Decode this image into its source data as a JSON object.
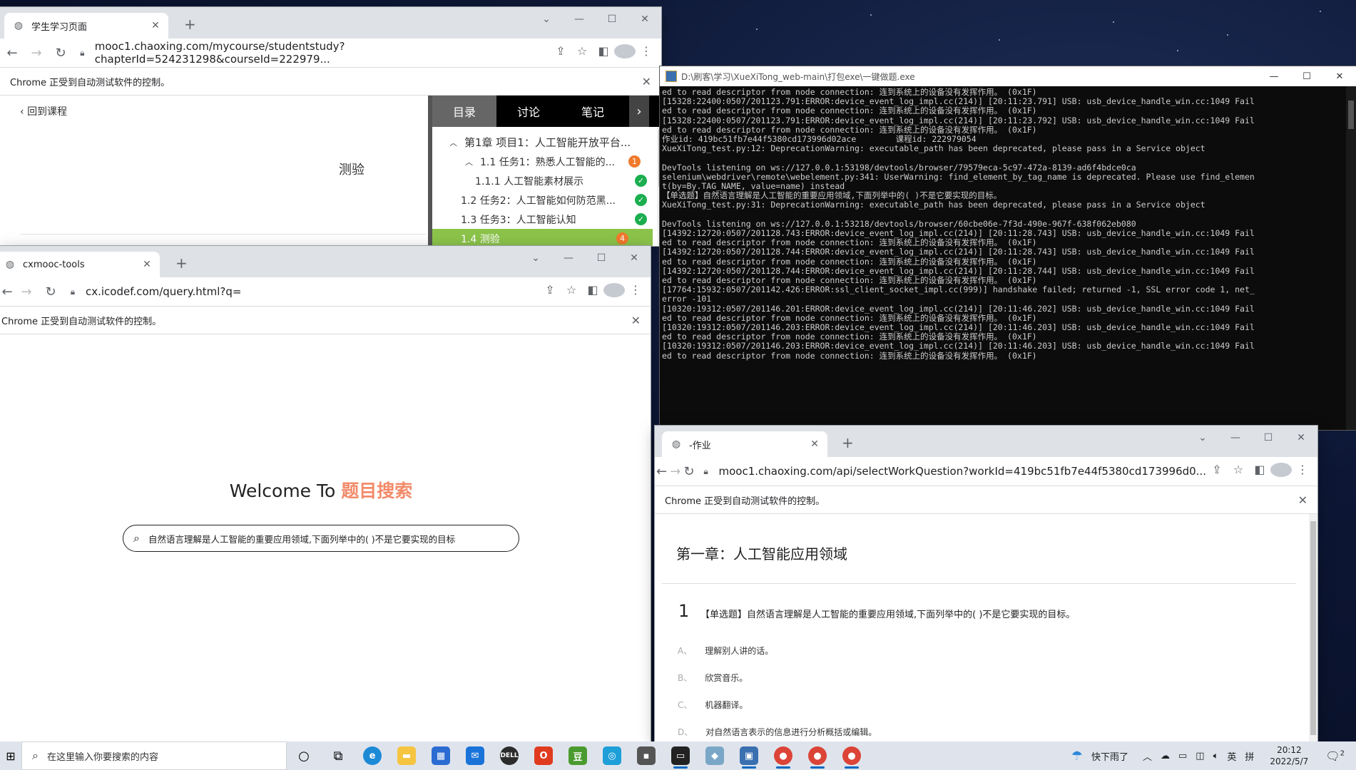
{
  "win1": {
    "tab_title": "学生学习页面",
    "url": "mooc1.chaoxing.com/mycourse/studentstudy?chapterId=524231298&courseId=222979...",
    "infobar": "Chrome 正受到自动测试软件的控制。",
    "back_link": "回到课程",
    "heading": "测验",
    "side_tabs": [
      "目录",
      "讨论",
      "笔记"
    ],
    "chapters": [
      {
        "label": "第1章 项目1：人工智能开放平台...",
        "status": ""
      },
      {
        "label": "1.1 任务1：熟悉人工智能的...",
        "status": "1"
      },
      {
        "label": "1.1.1 人工智能素材展示",
        "status": "done"
      },
      {
        "label": "1.2 任务2：人工智能如何防范黑...",
        "status": "done"
      },
      {
        "label": "1.3 任务3：人工智能认知",
        "status": "done"
      },
      {
        "label": "1.4 测验",
        "status": "4"
      }
    ]
  },
  "win2": {
    "tab_title": "cxmooc-tools",
    "url": "cx.icodef.com/query.html?q=",
    "infobar": "Chrome 正受到自动测试软件的控制。",
    "welcome": "Welcome To",
    "brand": "题目搜索",
    "search_value": "自然语言理解是人工智能的重要应用领域,下面列举中的( )不是它要实现的目标"
  },
  "console": {
    "title": "D:\\刷客\\学习\\XueXiTong_web-main\\打包exe\\一键做题.exe",
    "lines": [
      "ed to read descriptor from node connection: 连到系统上的设备没有发挥作用。 (0x1F)",
      "[15328:22400:0507/201123.791:ERROR:device_event_log_impl.cc(214)] [20:11:23.791] USB: usb_device_handle_win.cc:1049 Fail",
      "ed to read descriptor from node connection: 连到系统上的设备没有发挥作用。 (0x1F)",
      "[15328:22400:0507/201123.791:ERROR:device_event_log_impl.cc(214)] [20:11:23.792] USB: usb_device_handle_win.cc:1049 Fail",
      "ed to read descriptor from node connection: 连到系统上的设备没有发挥作用。 (0x1F)",
      "作业id: 419bc51fb7e44f5380cd173996d02ace        课程id: 222979054",
      "XueXiTong_test.py:12: DeprecationWarning: executable_path has been deprecated, please pass in a Service object",
      "",
      "DevTools listening on ws://127.0.0.1:53198/devtools/browser/79579eca-5c97-472a-8139-ad6f4bdce0ca",
      "selenium\\webdriver\\remote\\webelement.py:341: UserWarning: find_element_by_tag_name is deprecated. Please use find_elemen",
      "t(by=By.TAG_NAME, value=name) instead",
      "【单选题】自然语言理解是人工智能的重要应用领域,下面列举中的( )不是它要实现的目标。",
      "XueXiTong_test.py:31: DeprecationWarning: executable_path has been deprecated, please pass in a Service object",
      "",
      "DevTools listening on ws://127.0.0.1:53218/devtools/browser/60cbe06e-7f3d-490e-967f-638f062eb080",
      "[14392:12720:0507/201128.743:ERROR:device_event_log_impl.cc(214)] [20:11:28.743] USB: usb_device_handle_win.cc:1049 Fail",
      "ed to read descriptor from node connection: 连到系统上的设备没有发挥作用。 (0x1F)",
      "[14392:12720:0507/201128.744:ERROR:device_event_log_impl.cc(214)] [20:11:28.743] USB: usb_device_handle_win.cc:1049 Fail",
      "ed to read descriptor from node connection: 连到系统上的设备没有发挥作用。 (0x1F)",
      "[14392:12720:0507/201128.744:ERROR:device_event_log_impl.cc(214)] [20:11:28.744] USB: usb_device_handle_win.cc:1049 Fail",
      "ed to read descriptor from node connection: 连到系统上的设备没有发挥作用。 (0x1F)",
      "[17764:15932:0507/201142.426:ERROR:ssl_client_socket_impl.cc(999)] handshake failed; returned -1, SSL error code 1, net_",
      "error -101",
      "[10320:19312:0507/201146.201:ERROR:device_event_log_impl.cc(214)] [20:11:46.202] USB: usb_device_handle_win.cc:1049 Fail",
      "ed to read descriptor from node connection: 连到系统上的设备没有发挥作用。 (0x1F)",
      "[10320:19312:0507/201146.203:ERROR:device_event_log_impl.cc(214)] [20:11:46.203] USB: usb_device_handle_win.cc:1049 Fail",
      "ed to read descriptor from node connection: 连到系统上的设备没有发挥作用。 (0x1F)",
      "[10320:19312:0507/201146.203:ERROR:device_event_log_impl.cc(214)] [20:11:46.203] USB: usb_device_handle_win.cc:1049 Fail",
      "ed to read descriptor from node connection: 连到系统上的设备没有发挥作用。 (0x1F)"
    ]
  },
  "win3": {
    "tab_title": "-作业",
    "url": "mooc1.chaoxing.com/api/selectWorkQuestion?workId=419bc51fb7e44f5380cd173996d0...",
    "infobar": "Chrome 正受到自动测试软件的控制。",
    "chapter_title": "第一章：人工智能应用领域",
    "q_number": "1",
    "q_text": "【单选题】自然语言理解是人工智能的重要应用领域,下面列举中的( )不是它要实现的目标。",
    "options": [
      {
        "key": "A、",
        "text": "理解别人讲的话。"
      },
      {
        "key": "B、",
        "text": "欣赏音乐。"
      },
      {
        "key": "C、",
        "text": "机器翻译。"
      },
      {
        "key": "D、",
        "text": "对自然语言表示的信息进行分析概括或编辑。"
      }
    ]
  },
  "taskbar": {
    "search_placeholder": "在这里输入你要搜索的内容",
    "weather": "快下雨了",
    "ime": "英",
    "ime2": "拼",
    "time": "20:12",
    "date": "2022/5/7",
    "notif_count": "2"
  }
}
